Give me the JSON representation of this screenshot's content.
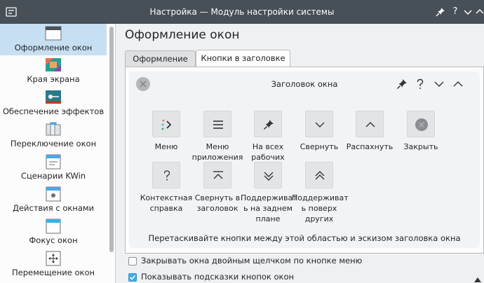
{
  "window": {
    "title": "Настройка — Модуль настройки системы",
    "controls": [
      "pin-icon",
      "help-icon",
      "minimize-icon",
      "maximize-icon"
    ]
  },
  "sidebar": {
    "items": [
      {
        "label": "Оформление окон",
        "icon": "window-decoration-icon",
        "active": true
      },
      {
        "label": "Края экрана",
        "icon": "screen-edges-icon"
      },
      {
        "label": "Обеспечение эффектов",
        "icon": "effects-icon"
      },
      {
        "label": "Переключение окон",
        "icon": "task-switcher-icon"
      },
      {
        "label": "Сценарии KWin",
        "icon": "kwin-scripts-icon"
      },
      {
        "label": "Действия с окнами",
        "icon": "window-actions-icon"
      },
      {
        "label": "Фокус окон",
        "icon": "window-focus-icon"
      },
      {
        "label": "Перемещение окон",
        "icon": "window-move-icon"
      }
    ]
  },
  "main": {
    "page_title": "Оформление окон",
    "tabs": [
      {
        "label": "Оформление",
        "active": false
      },
      {
        "label": "Кнопки в заголовке",
        "active": true
      }
    ],
    "preview": {
      "title": "Заголовок окна"
    },
    "buttons": [
      {
        "label": "Меню",
        "icon": "menu-dots-icon"
      },
      {
        "label": "Меню\nприложения",
        "icon": "hamburger-icon"
      },
      {
        "label": "На всех\nрабочих",
        "icon": "pin-icon"
      },
      {
        "label": "Свернуть",
        "icon": "chevron-down-icon"
      },
      {
        "label": "Распахнуть",
        "icon": "chevron-up-icon"
      },
      {
        "label": "Закрыть",
        "icon": "close-circle-icon"
      },
      {
        "label": "Контекстная\nсправка",
        "icon": "question-icon"
      },
      {
        "label": "Свернуть в\nзаголовок",
        "icon": "shade-icon"
      },
      {
        "label": "Поддерживат\nь на заднем\nплане",
        "icon": "keep-below-icon"
      },
      {
        "label": "Поддерживат\nь поверх\nдругих",
        "icon": "keep-above-icon"
      }
    ],
    "hint": "Перетаскивайте кнопки между этой областью и эскизом заголовка окна",
    "checkboxes": [
      {
        "label": "Закрывать окна двойным щелчком по кнопке меню",
        "checked": false
      },
      {
        "label": "Показывать подсказки кнопок окон",
        "checked": true
      }
    ]
  },
  "colors": {
    "titlebar": "#475057",
    "accent": "#3daee9",
    "sidebar_active": "#c6dff2"
  }
}
